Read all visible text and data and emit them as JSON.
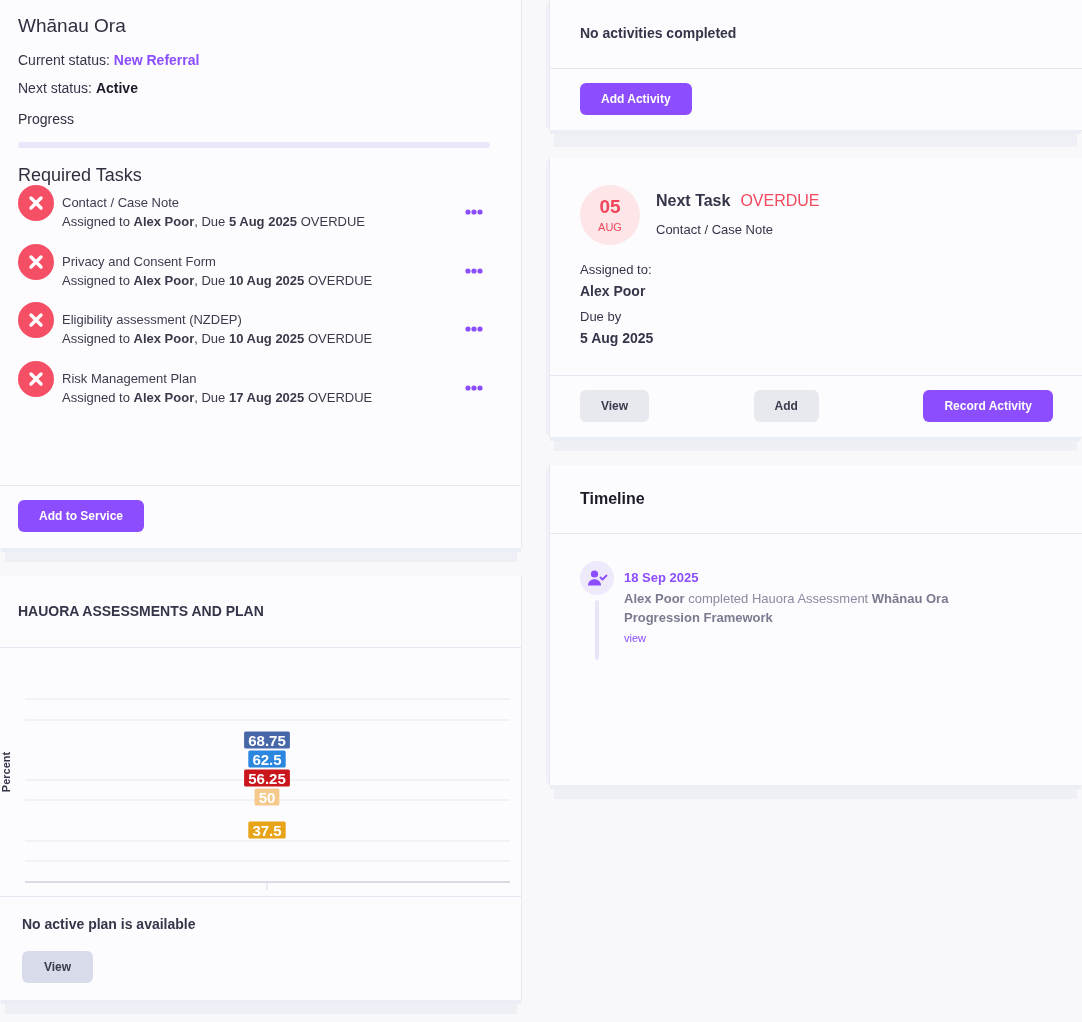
{
  "client": {
    "name": "Whānau Ora",
    "current_status_label": "Current status:",
    "current_status": "New Referral",
    "next_status_label": "Next status:",
    "next_status": "Active",
    "progress_label": "Progress",
    "progress": {
      "level": 0
    }
  },
  "required_tasks": {
    "title": "Required Tasks",
    "tasks": [
      {
        "title": "Contact / Case Note",
        "details": "Assigned to **Alex Poor**, Due **5 Aug 2025** OVERDUE",
        "done": false
      },
      {
        "title": "Privacy and Consent Form",
        "details": "Assigned to **Alex Poor**, Due **10 Aug 2025** OVERDUE",
        "done": false
      },
      {
        "title": "Eligibility assessment (NZDEP)",
        "details": "Assigned to **Alex Poor**, Due **10 Aug 2025** OVERDUE",
        "done": false
      },
      {
        "title": "Risk Management Plan",
        "details": "Assigned to **Alex Poor**, Due **17 Aug 2025** OVERDUE",
        "done": false
      }
    ],
    "add_button": "Add to Service"
  },
  "hauora": {
    "title": "HAUORA ASSESSMENTS AND PLAN",
    "assessment_chart": {
      "ylabel": "Percent",
      "data_labels": [
        {
          "text": "68.75",
          "color": "#4767a8"
        },
        {
          "text": "62.5",
          "color": "#2a86de"
        },
        {
          "text": "56.25",
          "color": "#c9161c"
        },
        {
          "text": "50",
          "color": "#f5c88c"
        },
        {
          "text": "37.5",
          "color": "#e8a419"
        }
      ]
    },
    "plan_message": "No active plan is available",
    "view_button": "View"
  },
  "activities": {
    "message": "No activities completed",
    "add_button": "Add Activity"
  },
  "next_task": {
    "day": "05",
    "month": "AUG",
    "title": "Next Task",
    "status": "OVERDUE",
    "task": "Contact / Case Note",
    "assigned_label": "Assigned to:",
    "assignee": "Alex Poor",
    "due_label": "Due by",
    "due_date": "5 Aug 2025",
    "buttons": [
      {
        "label": "View",
        "kind": "secondary"
      },
      {
        "label": "Add",
        "kind": "secondary"
      },
      {
        "label": "Record Activity",
        "kind": "primary"
      }
    ]
  },
  "timeline": {
    "title": "Timeline",
    "events": [
      {
        "date": "18 Sep 2025",
        "text": "**Alex Poor** completed Hauora Assessment **Whānau Ora Progression Framework**",
        "link": "view"
      }
    ]
  }
}
